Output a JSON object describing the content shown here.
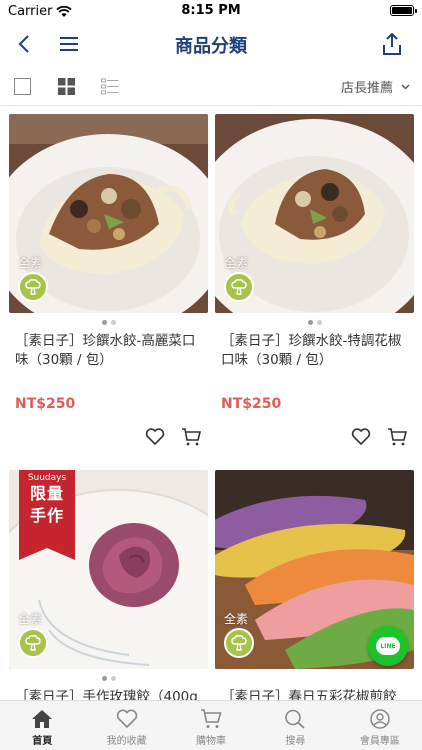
{
  "status": {
    "carrier": "Carrier",
    "time": "8:15 PM"
  },
  "nav": {
    "title": "商品分類"
  },
  "toolbar": {
    "sort_label": "店長推薦"
  },
  "colors": {
    "brand": "#1f3f7a",
    "price": "#e35a5a",
    "veg_badge": "#a9c34a",
    "ribbon": "#c4252f",
    "line": "#1cc32b"
  },
  "products": [
    {
      "name": "［素日子］珍饌水餃-高麗菜口味（30顆 / 包）",
      "price": "NT$250",
      "tag": "全素"
    },
    {
      "name": "［素日子］珍饌水餃-特調花椒口味（30顆 / 包）",
      "price": "NT$250",
      "tag": "全素"
    },
    {
      "name": "［素日子］手作玫瑰餃（400g",
      "tag": "全素",
      "ribbon_small": "Suudays",
      "ribbon_line1": "限量",
      "ribbon_line2": "手作"
    },
    {
      "name": "［素日子］春日五彩花椒煎餃",
      "tag": "全素"
    }
  ],
  "line_button": {
    "label": "LINE"
  },
  "tabs": [
    {
      "label": "首頁",
      "icon": "home-icon",
      "active": true
    },
    {
      "label": "我的收藏",
      "icon": "heart-icon"
    },
    {
      "label": "購物車",
      "icon": "cart-icon"
    },
    {
      "label": "搜尋",
      "icon": "search-icon"
    },
    {
      "label": "會員專區",
      "icon": "user-icon"
    }
  ]
}
